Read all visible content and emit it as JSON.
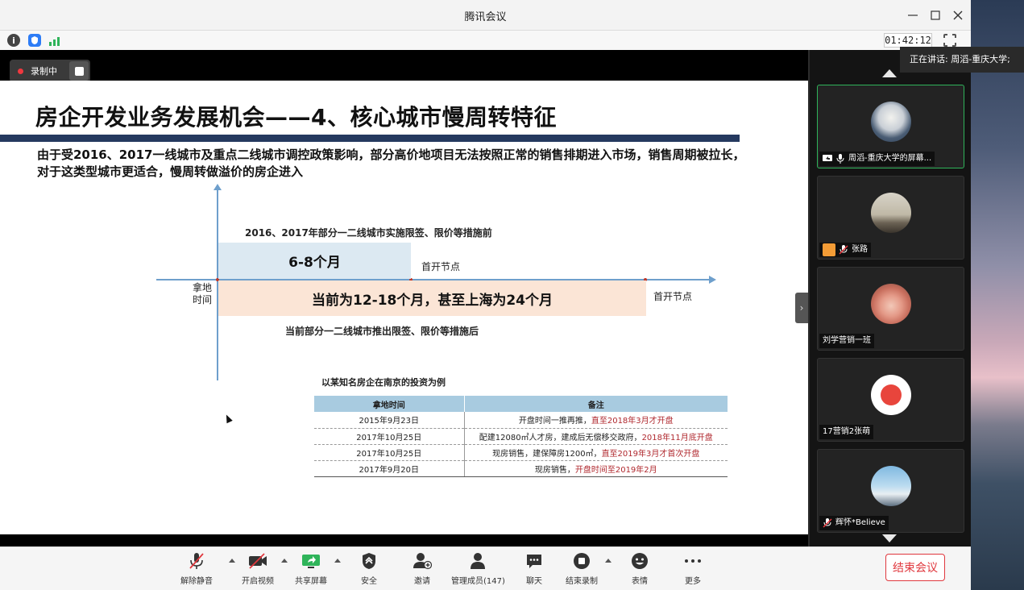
{
  "window": {
    "title": "腾讯会议"
  },
  "infobar": {
    "timer": "01:42:12",
    "icons": [
      "info-icon",
      "shield-icon",
      "signal-icon"
    ]
  },
  "recording": {
    "label": "录制中"
  },
  "speaking": {
    "text": "正在讲话: 周滔-重庆大学;"
  },
  "slide": {
    "title": "房企开发业务发展机会——4、核心城市慢周转特征",
    "subtitle": "由于受2016、2017一线城市及重点二线城市调控政策影响，部分高价地项目无法按照正常的销售排期进入市场，销售周期被拉长，对于这类型城市更适合，慢周转做溢价的房企进入",
    "before_label": "2016、2017年部分一二线城市实施限签、限价等措施前",
    "before_bar": "6-8个月",
    "node_label_1": "首开节点",
    "land_label": "拿地时间",
    "after_bar": "当前为12-18个月，甚至上海为24个月",
    "node_label_2": "首开节点",
    "after_label": "当前部分一二线城市推出限签、限价等措施后",
    "example_caption": "以某知名房企在南京的投资为例",
    "table": {
      "headers": [
        "拿地时间",
        "备注"
      ],
      "rows": [
        {
          "date": "2015年9月23日",
          "note_black": "开盘时间一推再推，",
          "note_red": "直至2018年3月才开盘"
        },
        {
          "date": "2017年10月25日",
          "note_black": "配建12080㎡人才房，建成后无偿移交政府，",
          "note_red": "2018年11月底开盘"
        },
        {
          "date": "2017年10月25日",
          "note_black": "现房销售，建保障房1200㎡，",
          "note_red": "直至2019年3月才首次开盘"
        },
        {
          "date": "2017年9月20日",
          "note_black": "现房销售，",
          "note_red": "开盘时间至2019年2月"
        }
      ]
    }
  },
  "participants": [
    {
      "name": "周滔-重庆大学的屏幕...",
      "active": true
    },
    {
      "name": "张路",
      "active": false
    },
    {
      "name": "刘学营销一班",
      "active": false
    },
    {
      "name": "17营销2张萌",
      "active": false
    },
    {
      "name": "辉怀*Believe",
      "active": false
    }
  ],
  "toolbar": {
    "items": [
      {
        "label": "解除静音"
      },
      {
        "label": "开启视频"
      },
      {
        "label": "共享屏幕"
      },
      {
        "label": "安全"
      },
      {
        "label": "邀请"
      },
      {
        "label": "管理成员(147)"
      },
      {
        "label": "聊天"
      },
      {
        "label": "结束录制"
      },
      {
        "label": "表情"
      },
      {
        "label": "更多"
      }
    ],
    "end_label": "结束会议"
  },
  "colors": {
    "accent_green": "#2fb45a",
    "end_red": "#e0383e",
    "slide_rule": "#25395f",
    "note_red": "#b0282e"
  }
}
